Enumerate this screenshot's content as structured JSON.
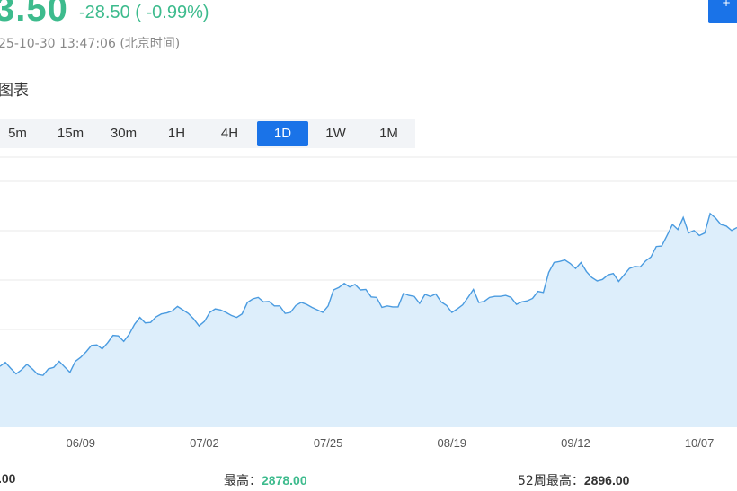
{
  "quote": {
    "price": "3.50",
    "change": "-28.50 ( -0.99%)",
    "timestamp": "25-10-30 13:47:06  (北京时间)"
  },
  "header_button": {
    "label": "+"
  },
  "section": {
    "title": "图表"
  },
  "timeframe_tabs": [
    {
      "label": "5m"
    },
    {
      "label": "15m"
    },
    {
      "label": "30m"
    },
    {
      "label": "1H"
    },
    {
      "label": "4H"
    },
    {
      "label": "1D",
      "active": true
    },
    {
      "label": "1W"
    },
    {
      "label": "1M"
    }
  ],
  "colors": {
    "accent": "#1a73e8",
    "positive_text": "#3dbb8d",
    "line": "#4a9be0",
    "area_fill": "#ddeefb"
  },
  "chart_data": {
    "type": "area",
    "x_tick_labels": [
      "06/09",
      "07/02",
      "07/25",
      "08/19",
      "09/12",
      "10/07"
    ],
    "x_tick_index": [
      15,
      38,
      61,
      84,
      107,
      130
    ],
    "ylim": [
      2400,
      2950
    ],
    "grid": "horizontal",
    "values": [
      2522,
      2530,
      2518,
      2507,
      2515,
      2526,
      2517,
      2506,
      2504,
      2517,
      2520,
      2532,
      2521,
      2510,
      2532,
      2540,
      2551,
      2564,
      2565,
      2557,
      2569,
      2584,
      2583,
      2572,
      2586,
      2606,
      2620,
      2609,
      2610,
      2621,
      2627,
      2629,
      2633,
      2642,
      2635,
      2628,
      2617,
      2603,
      2612,
      2630,
      2637,
      2635,
      2630,
      2624,
      2620,
      2627,
      2650,
      2657,
      2660,
      2651,
      2652,
      2643,
      2643,
      2628,
      2630,
      2644,
      2650,
      2646,
      2640,
      2635,
      2630,
      2643,
      2675,
      2680,
      2688,
      2681,
      2686,
      2675,
      2676,
      2661,
      2660,
      2640,
      2643,
      2641,
      2641,
      2668,
      2664,
      2662,
      2648,
      2666,
      2662,
      2667,
      2651,
      2644,
      2630,
      2637,
      2645,
      2660,
      2676,
      2650,
      2652,
      2660,
      2662,
      2662,
      2664,
      2660,
      2646,
      2651,
      2653,
      2658,
      2672,
      2670,
      2710,
      2730,
      2732,
      2735,
      2728,
      2718,
      2730,
      2712,
      2700,
      2693,
      2696,
      2705,
      2708,
      2692,
      2705,
      2718,
      2722,
      2721,
      2733,
      2741,
      2762,
      2763,
      2784,
      2806,
      2796,
      2820,
      2789,
      2794,
      2784,
      2789,
      2828,
      2819,
      2806,
      2803,
      2794,
      2800
    ]
  },
  "stats": [
    {
      "label": "",
      "value": ".00"
    },
    {
      "label": "最高：",
      "value": "2878.00"
    },
    {
      "label": "52周最高：",
      "value": "2896.00"
    }
  ]
}
